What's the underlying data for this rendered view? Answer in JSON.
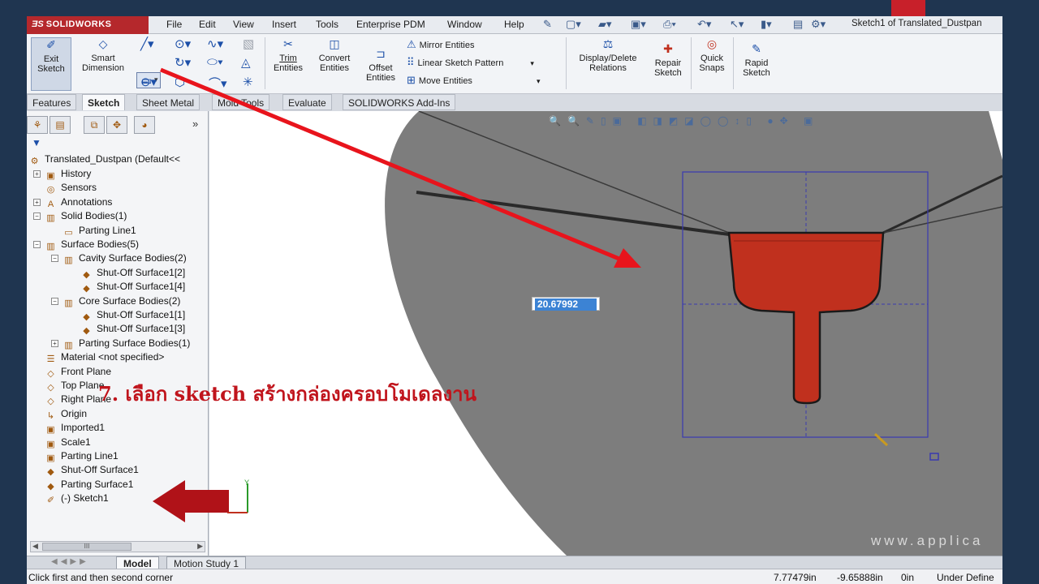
{
  "app": {
    "logo": "SOLIDWORKS",
    "document_title": "Sketch1 of Translated_Dustpan"
  },
  "menu": [
    "File",
    "Edit",
    "View",
    "Insert",
    "Tools",
    "Enterprise PDM",
    "Window",
    "Help"
  ],
  "toolbar": {
    "exit_sketch": [
      "Exit",
      "Sketch"
    ],
    "smart_dimension": [
      "Smart",
      "Dimension"
    ],
    "trim_entities": [
      "Trim",
      "Entities"
    ],
    "convert_entities": [
      "Convert",
      "Entities"
    ],
    "offset_entities": [
      "Offset",
      "Entities"
    ],
    "mirror_entities": "Mirror Entities",
    "linear_sketch_pattern": "Linear Sketch Pattern",
    "move_entities": "Move Entities",
    "display_delete_relations": [
      "Display/Delete",
      "Relations"
    ],
    "repair_sketch": [
      "Repair",
      "Sketch"
    ],
    "quick_snaps": [
      "Quick",
      "Snaps"
    ],
    "rapid_sketch": [
      "Rapid",
      "Sketch"
    ]
  },
  "tabs": [
    "Features",
    "Sketch",
    "Sheet Metal",
    "Mold Tools",
    "Evaluate",
    "SOLIDWORKS Add-Ins"
  ],
  "active_tab": "Sketch",
  "tree": {
    "root": "Translated_Dustpan  (Default<<",
    "nodes": [
      {
        "label": "History",
        "level": 0,
        "expander": "+"
      },
      {
        "label": "Sensors",
        "level": 0,
        "expander": ""
      },
      {
        "label": "Annotations",
        "level": 0,
        "expander": "+"
      },
      {
        "label": "Solid Bodies(1)",
        "level": 0,
        "expander": "−"
      },
      {
        "label": "Parting Line1",
        "level": 1,
        "expander": ""
      },
      {
        "label": "Surface Bodies(5)",
        "level": 0,
        "expander": "−"
      },
      {
        "label": "Cavity Surface Bodies(2)",
        "level": 1,
        "expander": "−"
      },
      {
        "label": "Shut-Off Surface1[2]",
        "level": 2,
        "expander": ""
      },
      {
        "label": "Shut-Off Surface1[4]",
        "level": 2,
        "expander": ""
      },
      {
        "label": "Core Surface Bodies(2)",
        "level": 1,
        "expander": "−"
      },
      {
        "label": "Shut-Off Surface1[1]",
        "level": 2,
        "expander": ""
      },
      {
        "label": "Shut-Off Surface1[3]",
        "level": 2,
        "expander": ""
      },
      {
        "label": "Parting Surface Bodies(1)",
        "level": 1,
        "expander": "+"
      },
      {
        "label": "Material <not specified>",
        "level": 0,
        "expander": ""
      },
      {
        "label": "Front Plane",
        "level": 0,
        "expander": ""
      },
      {
        "label": "Top Plane",
        "level": 0,
        "expander": ""
      },
      {
        "label": "Right Plane",
        "level": 0,
        "expander": ""
      },
      {
        "label": "Origin",
        "level": 0,
        "expander": ""
      },
      {
        "label": "Imported1",
        "level": 0,
        "expander": ""
      },
      {
        "label": "Scale1",
        "level": 0,
        "expander": ""
      },
      {
        "label": "Parting Line1",
        "level": 0,
        "expander": ""
      },
      {
        "label": "Shut-Off Surface1",
        "level": 0,
        "expander": ""
      },
      {
        "label": "Parting Surface1",
        "level": 0,
        "expander": ""
      },
      {
        "label": "(-) Sketch1",
        "level": 0,
        "expander": ""
      }
    ],
    "scroll_label": "III"
  },
  "viewport": {
    "dimension_value": "20.67992",
    "watermark": "www.applica",
    "instruction": "7. เลือก sketch สร้างกล่องครอบโมเดลงาน"
  },
  "bottom_tabs": [
    "Model",
    "Motion Study 1"
  ],
  "status": {
    "message": "Click first and then second corner",
    "x": "7.77479in",
    "y": "-9.65888in",
    "z": "0in",
    "state": "Under Define"
  },
  "colors": {
    "arrow": "#e8141c",
    "block_arrow": "#b01218",
    "sketch_box": "#3a3ab0",
    "part": "#c0301e"
  }
}
